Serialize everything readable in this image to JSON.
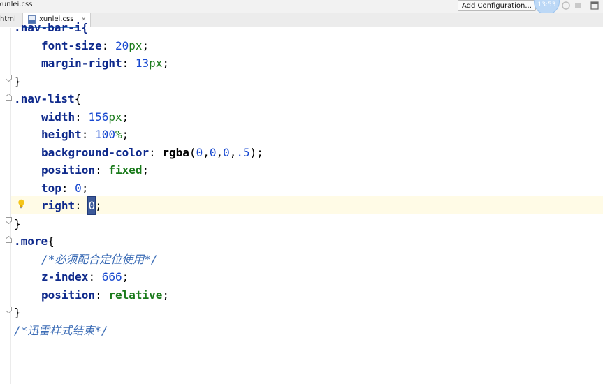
{
  "titlebar": {
    "window_title": "xunlei.css",
    "add_configuration_label": "Add Configuration...",
    "clock_text": "13:53"
  },
  "tabs": [
    {
      "label": "html"
    },
    {
      "label": "xunlei.css",
      "close": "×"
    }
  ],
  "editor": {
    "lines": [
      {
        "tokens": [
          {
            "t": "sel",
            "v": ".nav-bar-i{"
          }
        ]
      },
      {
        "tokens": [
          {
            "t": "prop",
            "v": "font-size"
          },
          {
            "t": "p",
            "v": ": "
          },
          {
            "t": "num",
            "v": "20"
          },
          {
            "t": "unit",
            "v": "px"
          },
          {
            "t": "p",
            "v": ";"
          }
        ]
      },
      {
        "tokens": [
          {
            "t": "prop",
            "v": "margin-right"
          },
          {
            "t": "p",
            "v": ": "
          },
          {
            "t": "num",
            "v": "13"
          },
          {
            "t": "unit",
            "v": "px"
          },
          {
            "t": "p",
            "v": ";"
          }
        ]
      },
      {
        "tokens": [
          {
            "t": "p",
            "v": "}"
          }
        ]
      },
      {
        "tokens": [
          {
            "t": "sel",
            "v": ".nav-list"
          },
          {
            "t": "p",
            "v": "{"
          }
        ]
      },
      {
        "tokens": [
          {
            "t": "prop",
            "v": "width"
          },
          {
            "t": "p",
            "v": ": "
          },
          {
            "t": "num",
            "v": "156"
          },
          {
            "t": "unit",
            "v": "px"
          },
          {
            "t": "p",
            "v": ";"
          }
        ]
      },
      {
        "tokens": [
          {
            "t": "prop",
            "v": "height"
          },
          {
            "t": "p",
            "v": ": "
          },
          {
            "t": "num",
            "v": "100"
          },
          {
            "t": "unit",
            "v": "%"
          },
          {
            "t": "p",
            "v": ";"
          }
        ]
      },
      {
        "tokens": [
          {
            "t": "prop",
            "v": "background-color"
          },
          {
            "t": "p",
            "v": ": "
          },
          {
            "t": "fn",
            "v": "rgba"
          },
          {
            "t": "p",
            "v": "("
          },
          {
            "t": "num",
            "v": "0"
          },
          {
            "t": "p",
            "v": ","
          },
          {
            "t": "num",
            "v": "0"
          },
          {
            "t": "p",
            "v": ","
          },
          {
            "t": "num",
            "v": "0"
          },
          {
            "t": "p",
            "v": ","
          },
          {
            "t": "num",
            "v": ".5"
          },
          {
            "t": "p",
            "v": ");"
          }
        ]
      },
      {
        "tokens": [
          {
            "t": "prop",
            "v": "position"
          },
          {
            "t": "p",
            "v": ": "
          },
          {
            "t": "kw",
            "v": "fixed"
          },
          {
            "t": "p",
            "v": ";"
          }
        ]
      },
      {
        "tokens": [
          {
            "t": "prop",
            "v": "top"
          },
          {
            "t": "p",
            "v": ": "
          },
          {
            "t": "num",
            "v": "0"
          },
          {
            "t": "p",
            "v": ";"
          }
        ]
      },
      {
        "tokens": [
          {
            "t": "prop",
            "v": "right"
          },
          {
            "t": "p",
            "v": ": "
          },
          {
            "t": "caret",
            "v": "0"
          },
          {
            "t": "p",
            "v": ";"
          }
        ]
      },
      {
        "tokens": [
          {
            "t": "p",
            "v": "}"
          }
        ]
      },
      {
        "tokens": [
          {
            "t": "sel",
            "v": ".more"
          },
          {
            "t": "p",
            "v": "{"
          }
        ]
      },
      {
        "tokens": [
          {
            "t": "cmt",
            "v": "/*必须配合定位使用*/"
          }
        ]
      },
      {
        "tokens": [
          {
            "t": "prop",
            "v": "z-index"
          },
          {
            "t": "p",
            "v": ": "
          },
          {
            "t": "num",
            "v": "666"
          },
          {
            "t": "p",
            "v": ";"
          }
        ]
      },
      {
        "tokens": [
          {
            "t": "prop",
            "v": "position"
          },
          {
            "t": "p",
            "v": ": "
          },
          {
            "t": "kw",
            "v": "relative"
          },
          {
            "t": "p",
            "v": ";"
          }
        ]
      },
      {
        "tokens": [
          {
            "t": "p",
            "v": "}"
          }
        ]
      },
      {
        "tokens": [
          {
            "t": "cmt",
            "v": "/*迅雷样式结束*/"
          }
        ]
      }
    ]
  }
}
